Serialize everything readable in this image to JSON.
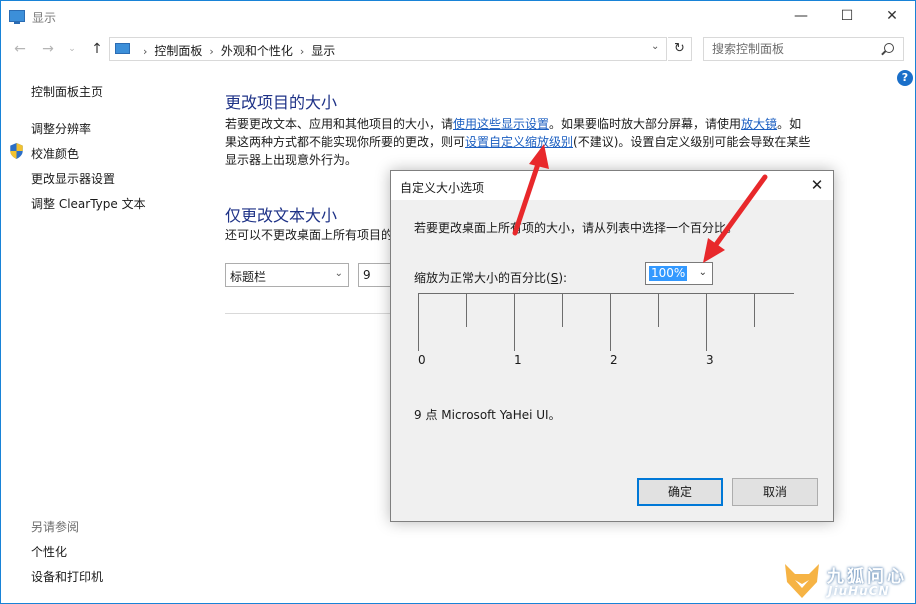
{
  "window": {
    "title": "显示"
  },
  "titlebar_controls": {
    "minimize": "—",
    "maximize": "☐",
    "close": "✕"
  },
  "nav": {
    "back": "←",
    "forward": "→",
    "recent": "⌄",
    "up": "↑",
    "refresh": "↻",
    "dropdown": "⌄"
  },
  "breadcrumbs": [
    "控制面板",
    "外观和个性化",
    "显示"
  ],
  "breadcrumb_sep": "›",
  "search": {
    "placeholder": "搜索控制面板"
  },
  "help": {
    "label": "?"
  },
  "sidebar": {
    "items": [
      {
        "label": "控制面板主页"
      },
      {
        "label": "调整分辨率"
      },
      {
        "label": "校准颜色"
      },
      {
        "label": "更改显示器设置"
      },
      {
        "label": "调整 ClearType 文本"
      }
    ],
    "see_also_title": "另请参阅",
    "see_also": [
      {
        "label": "个性化"
      },
      {
        "label": "设备和打印机"
      }
    ]
  },
  "main": {
    "heading_resize": "更改项目的大小",
    "para_1a": "若要更改文本、应用和其他项目的大小，请",
    "para_link1": "使用这些显示设置",
    "para_1b": "。如果要临时放大部分屏幕，请使用",
    "para_link2": "放大镜",
    "para_1c": "。如果这两种方式都不能实现你所要的更改，则可",
    "para_link3": "设置自定义缩放级别",
    "para_1d": "(不建议)。设置自定义级别可能会导致在某些显示器上出现意外行为。",
    "heading_text": "仅更改文本大小",
    "para_2": "还可以不更改桌面上所有项目的",
    "item_combo_value": "标题栏",
    "size_combo_value": "9"
  },
  "dialog": {
    "title": "自定义大小选项",
    "close": "✕",
    "instruction": "若要更改桌面上所有项的大小，请从列表中选择一个百分比。",
    "scale_label_a": "缩放为正常大小的百分比(",
    "scale_label_key": "S",
    "scale_label_b": "):",
    "scale_value": "100%",
    "ruler_labels": [
      "0",
      "1",
      "2",
      "3"
    ],
    "font_info": "9 点 Microsoft YaHei UI。",
    "ok_label": "确定",
    "cancel_label": "取消"
  },
  "annotation": {
    "arrow_color": "#e8282b"
  },
  "watermark": {
    "cn": "九狐问心",
    "en": "JiuHuCN"
  }
}
